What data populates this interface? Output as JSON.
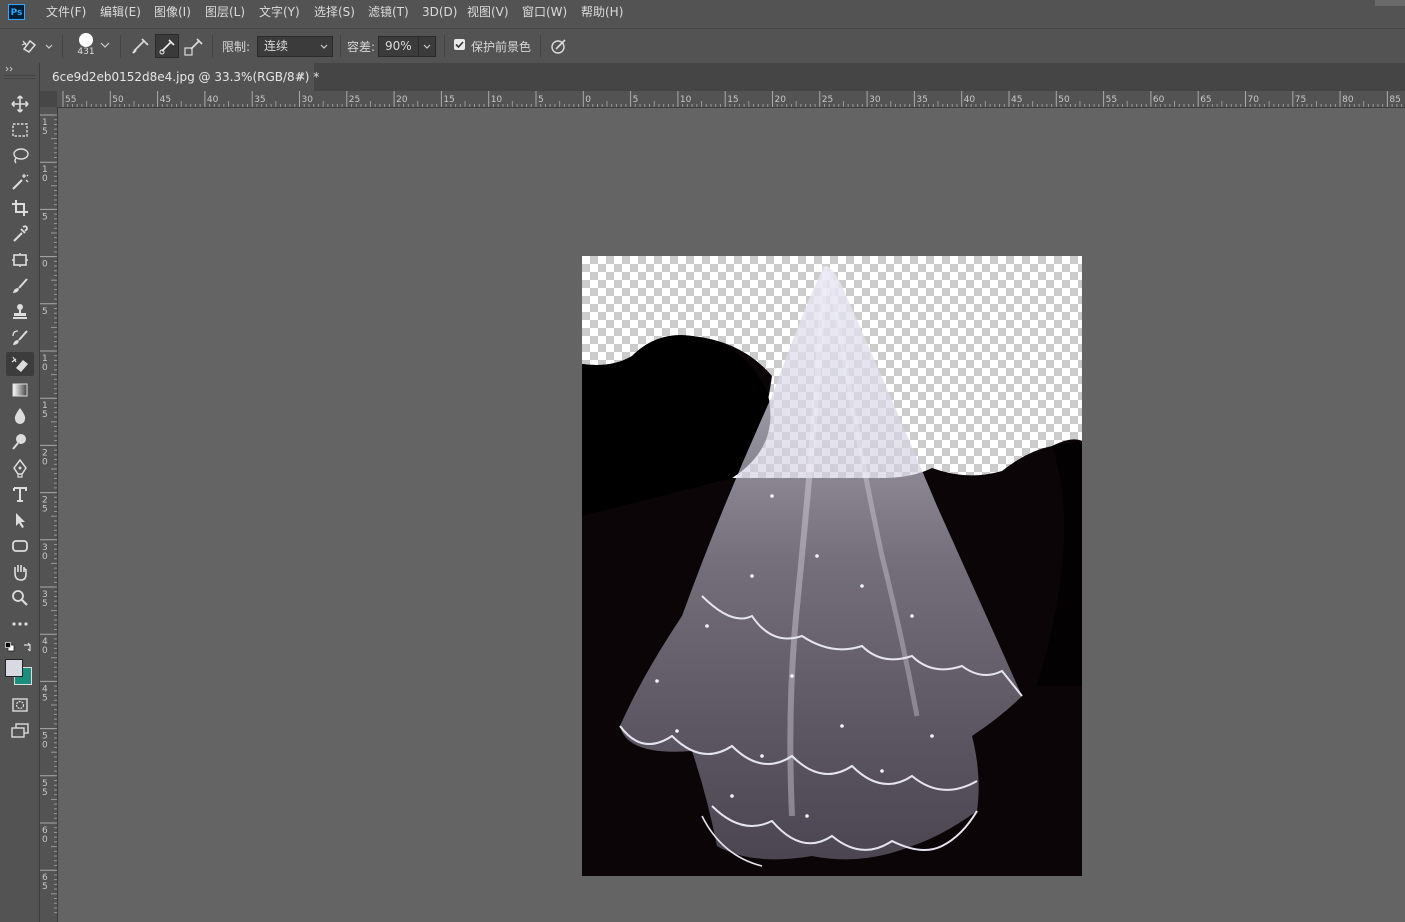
{
  "app": {
    "logo": "Ps"
  },
  "menu": [
    "文件(F)",
    "编辑(E)",
    "图像(I)",
    "图层(L)",
    "文字(Y)",
    "选择(S)",
    "滤镜(T)",
    "3D(D)",
    "视图(V)",
    "窗口(W)",
    "帮助(H)"
  ],
  "options": {
    "brush_size": "431",
    "limit_label": "限制:",
    "limit_value": "连续",
    "tolerance_label": "容差:",
    "tolerance_value": "90%",
    "protect_label": "保护前景色",
    "protect_checked": true
  },
  "document": {
    "tab_title": "6ce9d2eb0152d8e4.jpg @ 33.3%(RGB/8#) *",
    "close": "×"
  },
  "ruler": {
    "top_labels": [
      "55",
      "50",
      "45",
      "40",
      "35",
      "30",
      "25",
      "20",
      "15",
      "10",
      "5",
      "0",
      "5",
      "10",
      "15",
      "20",
      "25",
      "30",
      "35",
      "40",
      "45",
      "50",
      "55",
      "60",
      "65",
      "70",
      "75",
      "80",
      "85"
    ],
    "left_labels": [
      "15",
      "10",
      "5",
      "0",
      "5",
      "10",
      "15",
      "20",
      "25",
      "30",
      "35",
      "40",
      "45",
      "50",
      "55",
      "60",
      "65"
    ]
  },
  "tools": [
    "move-icon",
    "marquee-icon",
    "lasso-icon",
    "magic-wand-icon",
    "crop-icon",
    "eyedropper-icon",
    "frame-icon",
    "brush-icon",
    "stamp-icon",
    "history-brush-icon",
    "background-eraser-icon",
    "gradient-icon",
    "blur-icon",
    "dodge-icon",
    "pen-icon",
    "type-icon",
    "path-select-icon",
    "shape-icon",
    "hand-icon",
    "zoom-icon",
    "more-icon"
  ],
  "colors": {
    "foreground": "#d9d9e3",
    "background": "#1a8f7d"
  }
}
